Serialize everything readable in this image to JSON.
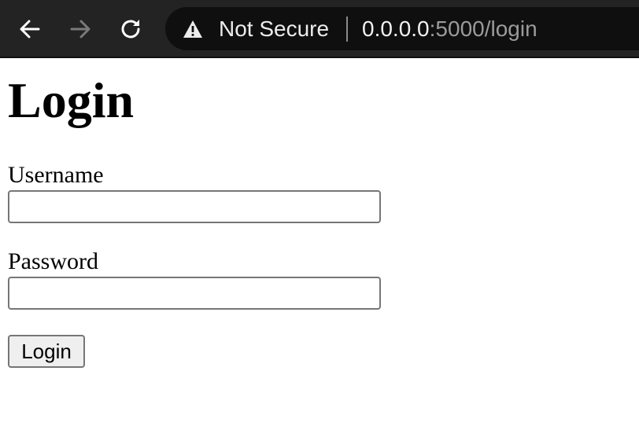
{
  "browser": {
    "security_label": "Not Secure",
    "url_host": "0.0.0.0",
    "url_rest": ":5000/login",
    "icons": {
      "back": "back-arrow-icon",
      "forward": "forward-arrow-icon",
      "reload": "reload-icon",
      "security": "warning-icon"
    }
  },
  "page": {
    "title": "Login",
    "username_label": "Username",
    "username_value": "",
    "password_label": "Password",
    "password_value": "",
    "submit_label": "Login"
  },
  "colors": {
    "toolbar_bg": "#232323",
    "omnibox_bg": "#0f0f0f",
    "page_bg": "#ffffff",
    "button_bg": "#efefef",
    "input_border": "#767676"
  }
}
